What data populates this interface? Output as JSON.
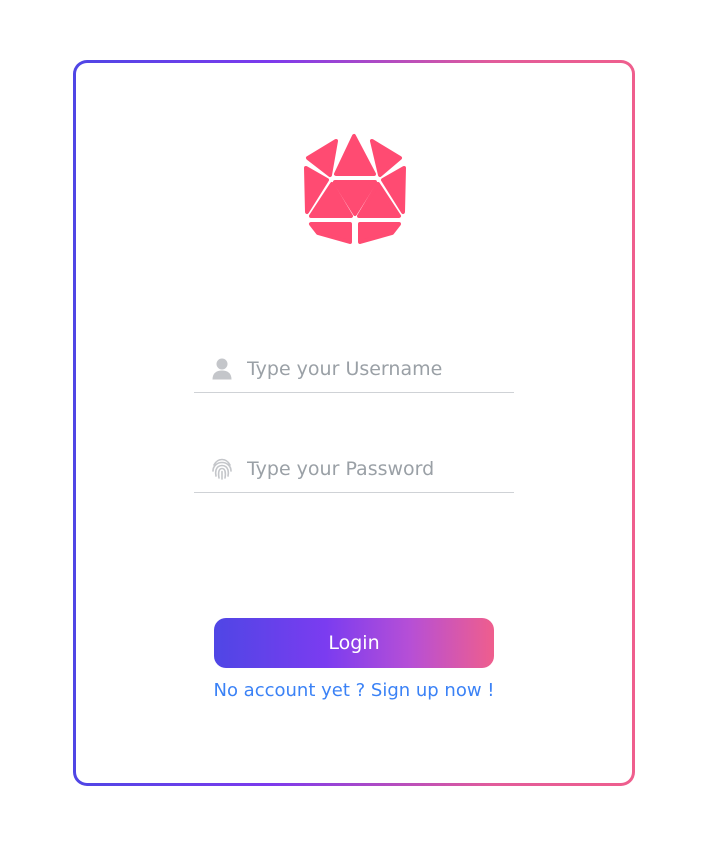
{
  "login_form": {
    "username": {
      "placeholder": "Type your Username",
      "value": "",
      "icon": "user-icon"
    },
    "password": {
      "placeholder": "Type your Password",
      "value": "",
      "icon": "fingerprint-icon"
    },
    "login_label": "Login",
    "signup_text": "No account yet ? Sign up now !"
  },
  "branding": {
    "logo_icon": "d20-icosahedron-logo",
    "logo_color": "#ff4b72"
  },
  "colors": {
    "gradient_start": "#4f46e5",
    "gradient_mid": "#7c3aed",
    "gradient_end": "#ef5e8d",
    "link": "#3b82f6",
    "icon_grey": "#c4c6ca",
    "placeholder": "#9aa0a6",
    "underline": "#cfd2d6"
  }
}
